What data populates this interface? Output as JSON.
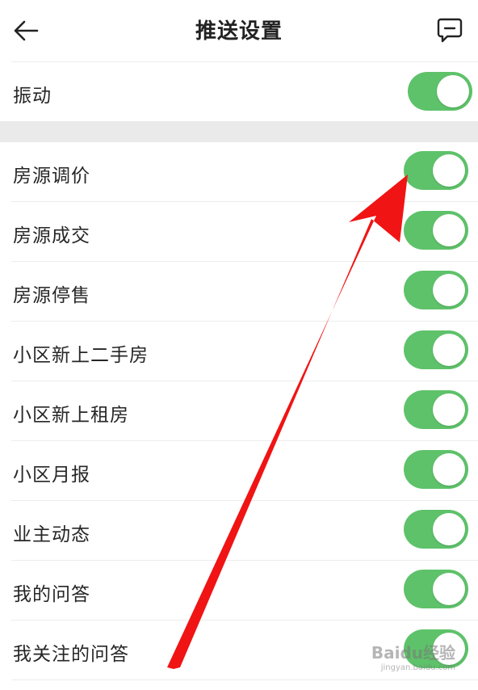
{
  "header": {
    "title": "推送设置",
    "back_icon": "arrow-left-icon",
    "feedback_icon": "message-square-icon"
  },
  "vibration": {
    "label": "振动",
    "enabled": true
  },
  "settings": [
    {
      "label": "房源调价",
      "enabled": true
    },
    {
      "label": "房源成交",
      "enabled": true
    },
    {
      "label": "房源停售",
      "enabled": true
    },
    {
      "label": "小区新上二手房",
      "enabled": true
    },
    {
      "label": "小区新上租房",
      "enabled": true
    },
    {
      "label": "小区月报",
      "enabled": true
    },
    {
      "label": "业主动态",
      "enabled": true
    },
    {
      "label": "我的问答",
      "enabled": true
    },
    {
      "label": "我关注的问答",
      "enabled": true
    }
  ],
  "colors": {
    "toggle_on": "#5ec26a",
    "arrow": "#f01414"
  },
  "watermark": {
    "text": "Baidu经验",
    "sub": "jingyan.baidu.com"
  }
}
